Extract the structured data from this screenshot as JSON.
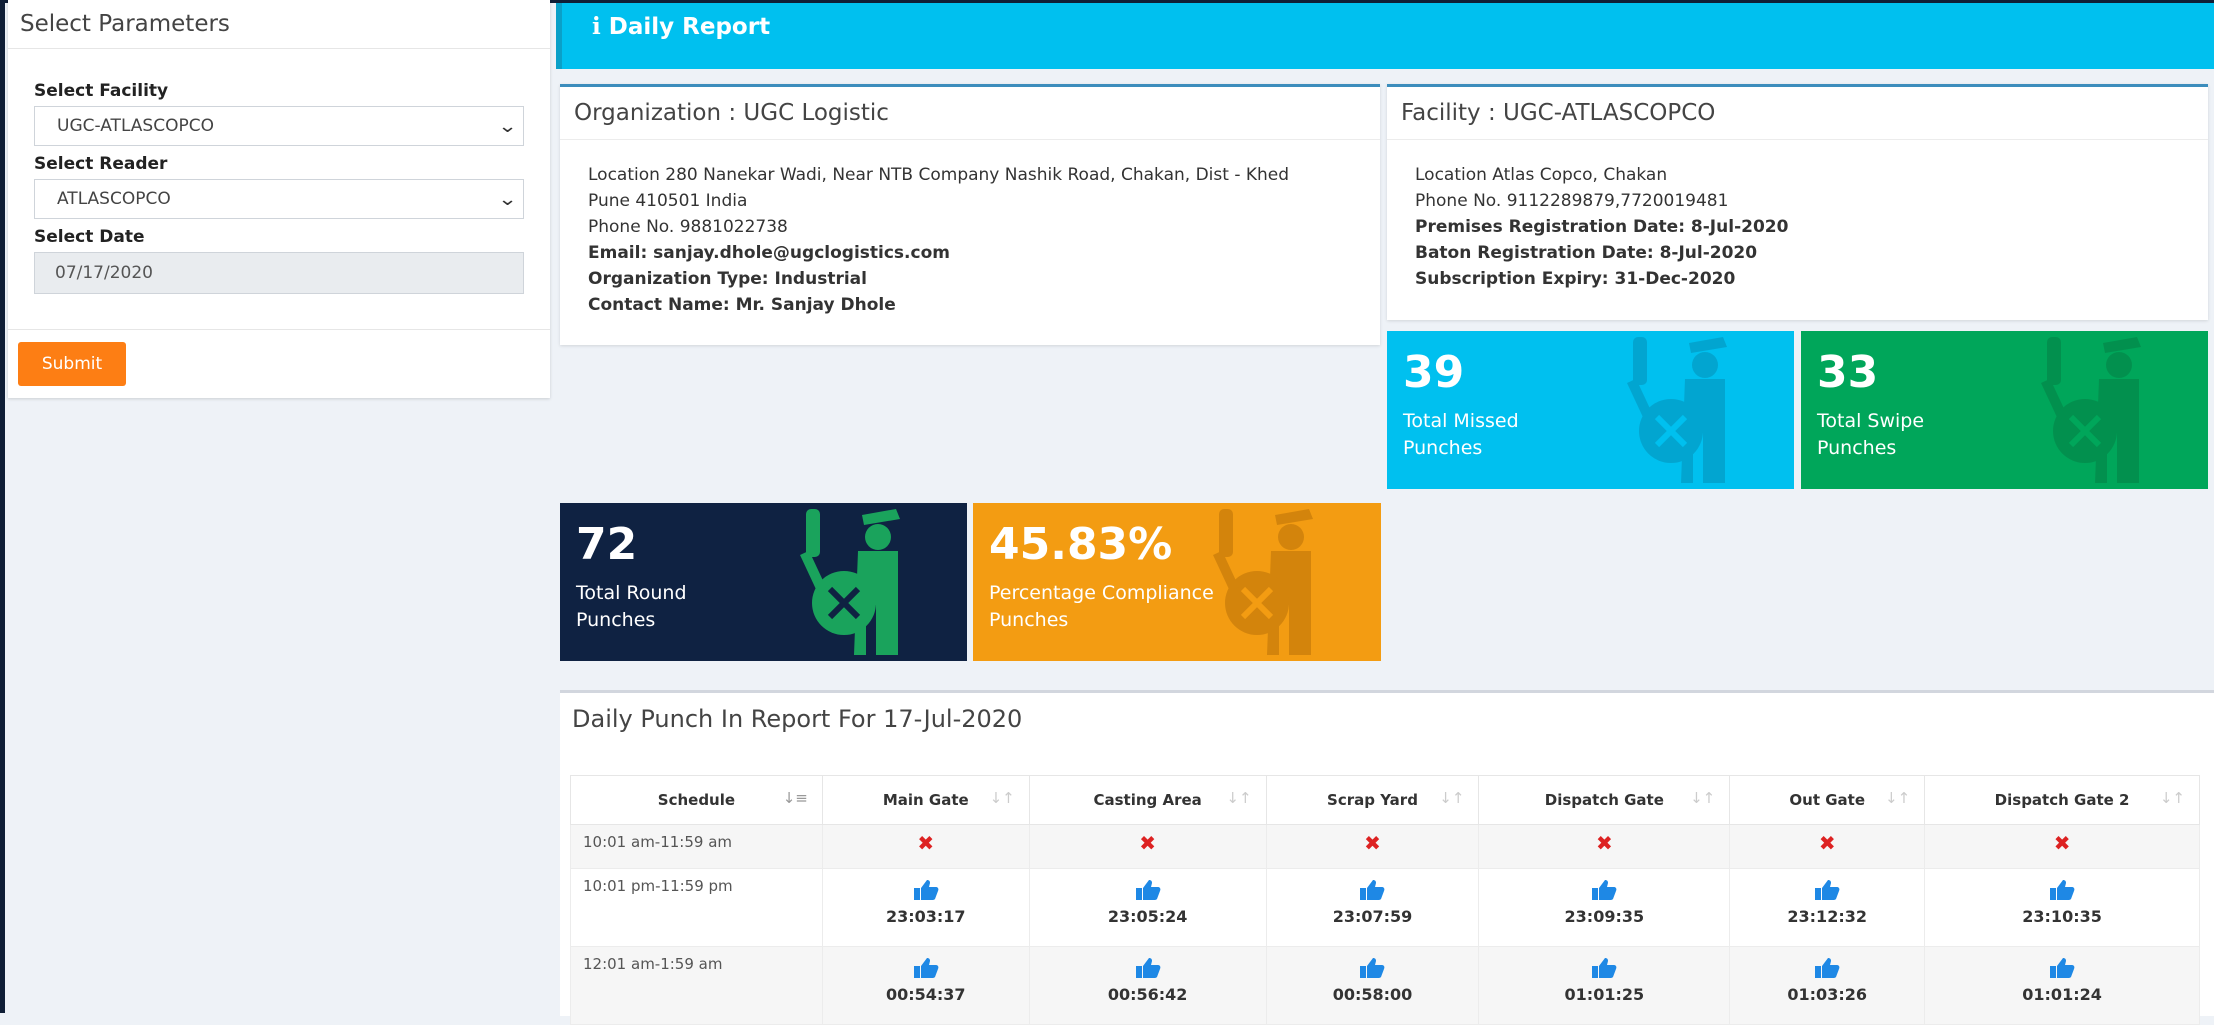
{
  "sidebar": {
    "title": "Select Parameters",
    "facility_label": "Select Facility",
    "facility_value": "UGC-ATLASCOPCO",
    "reader_label": "Select Reader",
    "reader_value": "ATLASCOPCO",
    "date_label": "Select Date",
    "date_value": "07/17/2020",
    "submit_label": "Submit"
  },
  "banner": {
    "icon": "info-icon",
    "title": "Daily Report"
  },
  "organization": {
    "title": "Organization : UGC Logistic",
    "location": "Location 280 Nanekar Wadi, Near NTB Company Nashik Road, Chakan, Dist - Khed",
    "location2": "Pune 410501 India",
    "phone": "Phone No. 9881022738",
    "email": "Email: sanjay.dhole@ugclogistics.com",
    "org_type": "Organization Type: Industrial",
    "contact": "Contact Name: Mr. Sanjay Dhole"
  },
  "facility": {
    "title": "Facility : UGC-ATLASCOPCO",
    "location": "Location Atlas Copco, Chakan",
    "phone": "Phone No. 9112289879,7720019481",
    "premises": "Premises Registration Date: 8-Jul-2020",
    "baton": "Baton Registration Date: 8-Jul-2020",
    "subscription": "Subscription Expiry: 31-Dec-2020"
  },
  "stats": {
    "missed": {
      "value": "39",
      "label1": "Total Missed",
      "label2": "Punches",
      "color": "#00c0ef"
    },
    "swipe": {
      "value": "33",
      "label1": "Total Swipe",
      "label2": "Punches",
      "color": "#00a65a"
    },
    "round": {
      "value": "72",
      "label1": "Total Round",
      "label2": "Punches",
      "color": "#0f2242"
    },
    "compliance": {
      "value": "45.83%",
      "label1": "Percentage Compliance",
      "label2": "Punches",
      "color": "#f39c12"
    }
  },
  "report": {
    "title": "Daily Punch In Report For 17-Jul-2020",
    "columns": [
      "Schedule",
      "Main Gate",
      "Casting Area",
      "Scrap Yard",
      "Dispatch Gate",
      "Out Gate",
      "Dispatch Gate 2"
    ],
    "rows": [
      {
        "schedule": "10:01 am-11:59 am",
        "times": [
          "",
          "",
          "",
          "",
          "",
          ""
        ]
      },
      {
        "schedule": "10:01 pm-11:59 pm",
        "times": [
          "23:03:17",
          "23:05:24",
          "23:07:59",
          "23:09:35",
          "23:12:32",
          "23:10:35"
        ]
      },
      {
        "schedule": "12:01 am-1:59 am",
        "times": [
          "00:54:37",
          "00:56:42",
          "00:58:00",
          "01:01:25",
          "01:03:26",
          "01:01:24"
        ]
      }
    ]
  }
}
